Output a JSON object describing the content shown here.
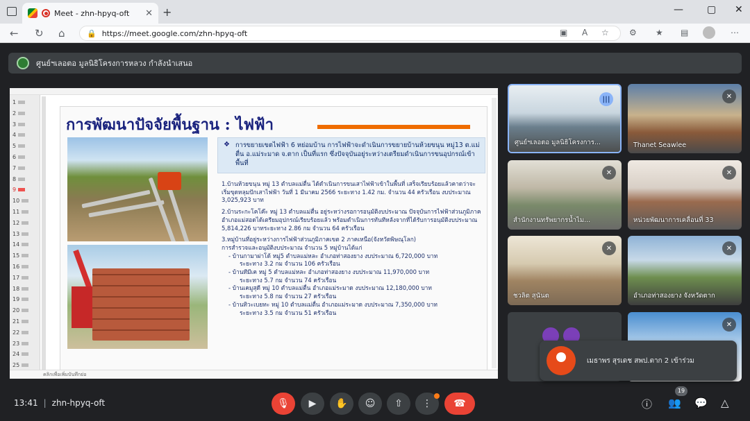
{
  "browser": {
    "tab_title": "Meet - zhn-hpyq-oft",
    "tab_close": "✕",
    "new_tab": "+",
    "url": "https://meet.google.com/zhn-hpyq-oft",
    "window_min": "—",
    "window_max": "▢",
    "window_close": "✕"
  },
  "banner": {
    "presenter_text": "ศูนย์ฯเลอตอ มูลนิธิโครงการหลวง กำลังนำเสนอ"
  },
  "slide": {
    "title": "การพัฒนาปัจจัยพื้นฐาน : ไฟฟ้า",
    "callout_bullet": "❖",
    "callout": "การขยายเขตไฟฟ้า 6 หย่อมบ้าน การไฟฟ้าจะดำเนินการขยายบ้านห้วยขนุน หมู่13 ต.แม่ตื่น อ.แม่ระมาด จ.ตาก เป็นที่แรก ซึ่งปัจจุบันอยู่ระหว่างเตรียมดำเนินการขนอุปกรณ์เข้าพื้นที่",
    "p1": "1.บ้านห้วยขนุน หมู่ 13 ตำบลแม่ตื่น ได้ดำเนินการขนเสาไฟฟ้าเข้าในพื้นที่ เสร็จเรียบร้อยแล้วคาดว่าจะเริ่มขุดหลุมปักเสาไฟฟ้า วันที่ 1 มีนาคม 2566 ระยะทาง 1.42 กม. จำนวน 44 ครัวเรือน งบประมาณ 3,025,923 บาท",
    "p2": "2.บ้านระกะโคโค๊ะ หมู่ 13 ตำบลแม่ตื่น อยู่ระหว่างรอการอนุมัติงบประมาณ ปัจจุบันการไฟฟ้าส่วนภูมิภาคอำเภอแม่สอดได้เตรียมอุปกรณ์เรียบร้อยแล้ว พร้อมดำเนินการทันทีหลังจากที่ได้รับการอนุมัติงบประมาณ 5,814,226 บาทระยะทาง 2.86 กม จำนวน 64 ครัวเรือน",
    "p3a": "3.หมู่บ้านที่อยู่ระหว่างการไฟฟ้าส่วนภูมิภาคเขต 2 ภาคเหนือ(จังหวัดพิษณุโลก)",
    "p3b": "การสำรวจและอนุมัติงบประมาณ จำนวน 5 หมู่บ้านได้แก่",
    "v1a": "- บ้านกามาผ่าโด้ หมู่5 ตำบลแม่หละ อำเภอท่าสองยาง งบประมาณ 6,720,000 บาท",
    "v1b": "ระยะทาง 3.2 กม จำนวน 106 ครัวเรือน",
    "v2a": "- บ้านทีมีเค หมู่ 5 ตำบลแม่หละ อำเภอท่าสองยาง งบประมาณ 11,970,000 บาท",
    "v2b": "ระยะทาง 5.7 กม จำนวน 74 ครัวเรือน",
    "v3a": "- บ้านเคมูสุดี หมู่ 10 ตำบลแม่ตื่น อำเภอแม่ระมาด งบประมาณ 12,180,000 บาท",
    "v3b": "ระยะทาง 5.8 กม จำนวน 27 ครัวเรือน",
    "v4a": "- บ้านทิวะเบยทะ หมู่ 10 ตำบลแม่ตื่น อำเภอแม่ระมาด งบประมาณ 7,350,000 บาท",
    "v4b": "ระยะทาง 3.5 กม จำนวน 51 ครัวเรือน",
    "notes_placeholder": "คลิกเพื่อเพิ่มบันทึกย่อ"
  },
  "thumbs": [
    "1",
    "2",
    "3",
    "4",
    "5",
    "6",
    "7",
    "8",
    "9",
    "10",
    "11",
    "12",
    "13",
    "14",
    "15",
    "16",
    "17",
    "18",
    "19",
    "20",
    "21",
    "22",
    "23",
    "24",
    "25"
  ],
  "selected_thumb": "9",
  "tiles": [
    {
      "name": "ศูนย์ฯเลอตอ มูลนิธิโครงการ...",
      "mic": "speaking"
    },
    {
      "name": "Thanet Seawlee",
      "mic": "muted"
    },
    {
      "name": "สำนักงานทรัพยากรน้ำไม...",
      "mic": "muted"
    },
    {
      "name": "หน่วยพัฒนาการเคลื่อนที่ 33",
      "mic": "muted"
    },
    {
      "name": "ชวลิต สุนันต",
      "mic": "muted"
    },
    {
      "name": "อำเภอท่าสองยาง จังหวัดตาก",
      "mic": "muted"
    },
    {
      "name": "",
      "mic": "none"
    },
    {
      "name": "",
      "mic": "muted"
    }
  ],
  "join_toast": {
    "text": "เมธาพร สุรเดช สพป.ตาก 2 เข้าร่วม"
  },
  "controls": {
    "time": "13:41",
    "separator": "|",
    "meeting_code": "zhn-hpyq-oft",
    "participants_count": "19"
  },
  "colors": {
    "meet_bg": "#202124",
    "end_call": "#ea4335",
    "slide_title": "#1a237e",
    "accent_rule": "#ef6c00"
  }
}
